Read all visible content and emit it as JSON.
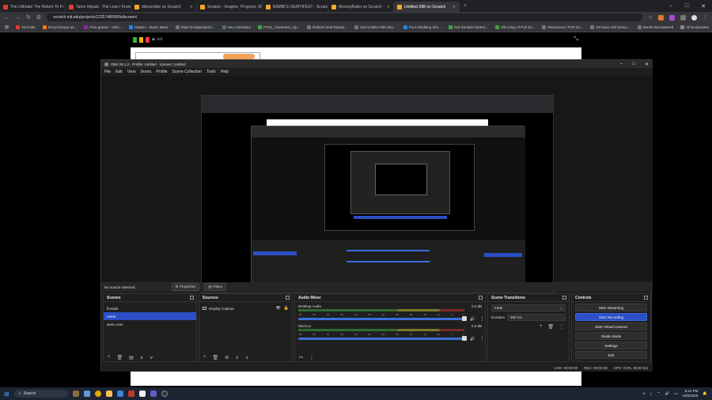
{
  "browser": {
    "tabs": [
      {
        "title": "The Ultimate The Return To Fr",
        "color": "#e53935"
      },
      {
        "title": "Tame Impala - The Less I Know",
        "color": "#e53935"
      },
      {
        "title": "ditezombie on Scratch",
        "color": "#f9a825"
      },
      {
        "title": "Scratch - Imagine, Program, Sh",
        "color": "#f9a825"
      },
      {
        "title": "BAMBI'S DEATHFEST - Scratch",
        "color": "#f9a825"
      },
      {
        "title": "MomoyBobio on Scratch",
        "color": "#f9a825"
      },
      {
        "title": "Untitled-288 on Scratch",
        "color": "#f9a825",
        "active": true
      }
    ],
    "url": "scratch.mit.edu/projects/1225748000/fullscreen/",
    "bookmarks": [
      {
        "label": "YouTube",
        "color": "#e53935"
      },
      {
        "label": "Groq! Recipe an...",
        "color": "#f57c00"
      },
      {
        "label": "Free games - 64Di...",
        "color": "#8e24aa"
      },
      {
        "label": "RawDJ - Music Mixer",
        "color": "#1e88e5"
      },
      {
        "label": "https://codeprojects...",
        "color": "#757575"
      },
      {
        "label": "Hex Calculator",
        "color": "#546e7a"
      },
      {
        "label": "PVZ1_Adventure_Sp...",
        "color": "#43a047"
      },
      {
        "label": "Bolbolo Mod Reposi...",
        "color": "#757575"
      },
      {
        "label": "Irion's MIDI Files (Du...",
        "color": "#757575"
      },
      {
        "label": "Pvz1 Modding Info...",
        "color": "#1e88e5"
      },
      {
        "label": "PvZ Zombie Advent...",
        "color": "#43a047"
      },
      {
        "label": "c/fe Copy of PvZ Zo...",
        "color": "#43a047"
      },
      {
        "label": "Resources | PVZ Do...",
        "color": "#757575"
      },
      {
        "label": "VS Dave Old Versio...",
        "color": "#757575"
      },
      {
        "label": "Bambi Remastered",
        "color": "#757575"
      }
    ],
    "all_bookmarks": "All Bookmarks"
  },
  "scratch": {
    "counter": "vnl"
  },
  "obs": {
    "title": "OBS 29.1.2 - Profile: Untitled - Scenes: Untitled",
    "menu": [
      "File",
      "Edit",
      "View",
      "Docks",
      "Profile",
      "Scene Collection",
      "Tools",
      "Help"
    ],
    "no_source": "No source selected",
    "properties": "Properties",
    "filters": "Filters",
    "scenes": {
      "title": "Scenes",
      "items": [
        "fireside",
        "normi",
        "wario cam"
      ],
      "selected": 1
    },
    "sources": {
      "title": "Sources",
      "items": [
        "Display Capture"
      ]
    },
    "mixer": {
      "title": "Audio Mixer",
      "channels": [
        {
          "name": "Desktop Audio",
          "db": "0.0 dB"
        },
        {
          "name": "Mic/Aux",
          "db": "0.0 dB"
        }
      ],
      "ticks": [
        "-60",
        "-55",
        "-50",
        "-45",
        "-40",
        "-35",
        "-30",
        "-25",
        "-20",
        "-15",
        "-10",
        "-5",
        "0"
      ]
    },
    "transitions": {
      "title": "Scene Transitions",
      "type": "Fade",
      "duration_label": "Duration",
      "duration": "300 ms"
    },
    "controls": {
      "title": "Controls",
      "buttons": [
        "Start Streaming",
        "Start Recording",
        "Start Virtual Camera",
        "Studio Mode",
        "Settings",
        "Exit"
      ],
      "active": 1
    },
    "status": {
      "live": "LIVE: 00:00:00",
      "rec": "REC: 00:00:00",
      "cpu": "CPU: 0.0%, 60.00 fps"
    }
  },
  "taskbar": {
    "search": "Search",
    "time": "8:24 PM",
    "date": "10/6/2025"
  }
}
